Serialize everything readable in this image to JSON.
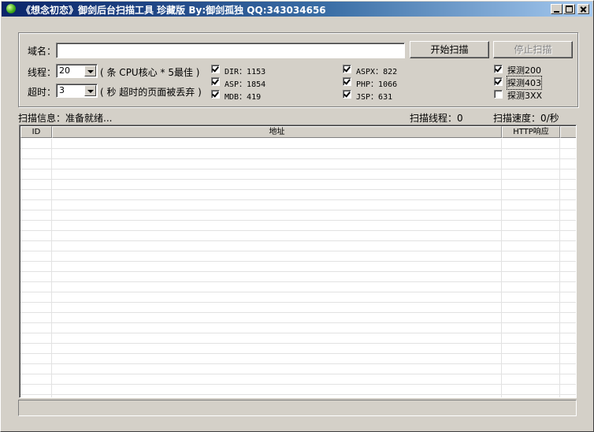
{
  "window": {
    "title": "《想念初恋》御剑后台扫描工具 珍藏版 By:御剑孤独 QQ:343034656"
  },
  "form": {
    "domain_label": "域名：",
    "domain_value": "",
    "threads_label": "线程：",
    "threads_value": "20",
    "threads_hint": "( 条 CPU核心 * 5最佳 )",
    "timeout_label": "超时：",
    "timeout_value": "3",
    "timeout_hint": "( 秒 超时的页面被丢弃 )",
    "start_button": "开始扫描",
    "stop_button": "停止扫描"
  },
  "dictionaries": [
    {
      "label": "DIR：1153",
      "checked": true
    },
    {
      "label": "ASP：1854",
      "checked": true
    },
    {
      "label": "MDB：419",
      "checked": true
    },
    {
      "label": "ASPX：822",
      "checked": true
    },
    {
      "label": "PHP：1066",
      "checked": true
    },
    {
      "label": "JSP：631",
      "checked": true
    }
  ],
  "probes": [
    {
      "label": "探测200",
      "checked": true
    },
    {
      "label": "探测403",
      "checked": true
    },
    {
      "label": "探测3XX",
      "checked": false
    }
  ],
  "info": {
    "scan_info": "扫描信息：准备就绪...",
    "scan_threads": "扫描线程：0",
    "scan_speed": "扫描速度：0/秒"
  },
  "table": {
    "columns": [
      "ID",
      "地址",
      "HTTP响应"
    ],
    "rows": []
  },
  "statusbar": {
    "text": ""
  }
}
